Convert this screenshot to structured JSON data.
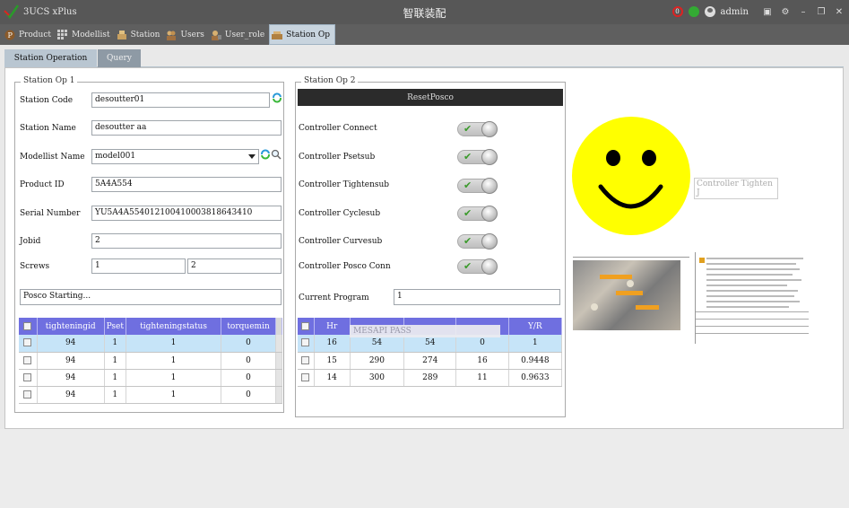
{
  "titlebar": {
    "app_name": "3UCS xPlus",
    "title": "智联装配",
    "status_count": "0",
    "user": "admin"
  },
  "nav": {
    "items": [
      {
        "label": "Product",
        "icon": "product-icon"
      },
      {
        "label": "Modellist",
        "icon": "modellist-icon"
      },
      {
        "label": "Station",
        "icon": "station-icon"
      },
      {
        "label": "Users",
        "icon": "users-icon"
      },
      {
        "label": "User_role",
        "icon": "user-role-icon"
      },
      {
        "label": "Station Op",
        "icon": "station-op-icon",
        "active": true
      }
    ]
  },
  "subtabs": {
    "station_operation": "Station Operation",
    "query": "Query"
  },
  "op1": {
    "title": "Station Op 1",
    "station_code_label": "Station Code",
    "station_code": "desoutter01",
    "station_name_label": "Station Name",
    "station_name": "desoutter aa",
    "modellist_label": "Modellist Name",
    "modellist": "model001",
    "product_id_label": "Product ID",
    "product_id": "5A4A554",
    "serial_label": "Serial Number",
    "serial": "YU5A4A554012100410003818643410",
    "jobid_label": "Jobid",
    "jobid": "2",
    "screws_label": "Screws",
    "screws_a": "1",
    "screws_b": "2",
    "status_text": "Posco Starting...",
    "table": {
      "headers": [
        "tighteningid",
        "Pset",
        "tighteningstatus",
        "torquemin"
      ],
      "rows": [
        [
          "94",
          "1",
          "1",
          "0"
        ],
        [
          "94",
          "1",
          "1",
          "0"
        ],
        [
          "94",
          "1",
          "1",
          "0"
        ],
        [
          "94",
          "1",
          "1",
          "0"
        ]
      ]
    }
  },
  "op2": {
    "title": "Station Op 2",
    "reset_label": "ResetPosco",
    "toggles": [
      "Controller Connect",
      "Controller Psetsub",
      "Controller Tightensub",
      "Controller Cyclesub",
      "Controller Curvesub",
      "Controller Posco Conn"
    ],
    "current_program_label": "Current Program",
    "current_program": "1",
    "table": {
      "headers": [
        "Hr",
        "",
        "",
        "",
        "Y/R"
      ],
      "overlay": "MESAPI PASS",
      "rows": [
        [
          "16",
          "54",
          "54",
          "0",
          "1"
        ],
        [
          "15",
          "290",
          "274",
          "16",
          "0.9448"
        ],
        [
          "14",
          "300",
          "289",
          "11",
          "0.9633"
        ]
      ]
    }
  },
  "right": {
    "tooltip": "Controller Tighten J",
    "smiley_color": "#ffff00"
  },
  "colors": {
    "header_blue": "#6f6fe0",
    "selected_row": "#c6e4f8",
    "titlebar": "#575757"
  }
}
